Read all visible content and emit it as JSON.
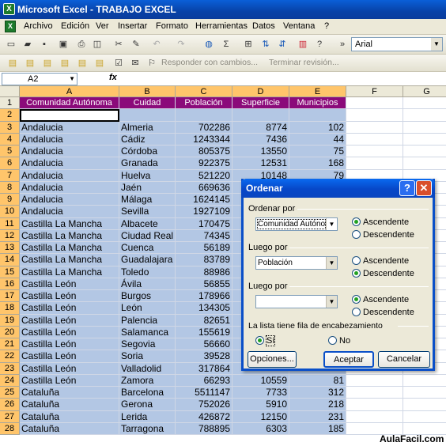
{
  "window": {
    "title": "Microsoft Excel - TRABAJO EXCEL"
  },
  "menu": [
    "Archivo",
    "Edición",
    "Ver",
    "Insertar",
    "Formato",
    "Herramientas",
    "Datos",
    "Ventana",
    "?"
  ],
  "toolbar": {
    "font": "Arial",
    "review_reply": "Responder con cambios...",
    "review_end": "Terminar revisión..."
  },
  "formula": {
    "cell_ref": "A2",
    "fx": "fx"
  },
  "columns": [
    "A",
    "B",
    "C",
    "D",
    "E",
    "F",
    "G"
  ],
  "headers": [
    "Comunidad Autónoma",
    "Cuidad",
    "Población",
    "Superficie",
    "Municipios"
  ],
  "rows": [
    {
      "n": "1"
    },
    {
      "n": "2"
    },
    {
      "n": "3",
      "a": "Andalucia",
      "b": "Almeria",
      "c": "702286",
      "d": "8774",
      "e": "102"
    },
    {
      "n": "4",
      "a": "Andalucia",
      "b": "Cádiz",
      "c": "1243344",
      "d": "7436",
      "e": "44"
    },
    {
      "n": "5",
      "a": "Andalucia",
      "b": "Córdoba",
      "c": "805375",
      "d": "13550",
      "e": "75"
    },
    {
      "n": "6",
      "a": "Andalucia",
      "b": "Granada",
      "c": "922375",
      "d": "12531",
      "e": "168"
    },
    {
      "n": "7",
      "a": "Andalucia",
      "b": "Huelva",
      "c": "521220",
      "d": "10148",
      "e": "79"
    },
    {
      "n": "8",
      "a": "Andalucia",
      "b": "Jaén",
      "c": "669636",
      "d": "",
      "e": ""
    },
    {
      "n": "9",
      "a": "Andalucia",
      "b": "Málaga",
      "c": "1624145",
      "d": "",
      "e": ""
    },
    {
      "n": "10",
      "a": "Andalucia",
      "b": "Sevilla",
      "c": "1927109",
      "d": "",
      "e": ""
    },
    {
      "n": "11",
      "a": "Castilla La Mancha",
      "b": "Albacete",
      "c": "170475",
      "d": "",
      "e": ""
    },
    {
      "n": "12",
      "a": "Castilla La Mancha",
      "b": "Ciudad Real",
      "c": "74345",
      "d": "",
      "e": ""
    },
    {
      "n": "13",
      "a": "Castilla La Mancha",
      "b": "Cuenca",
      "c": "56189",
      "d": "",
      "e": ""
    },
    {
      "n": "14",
      "a": "Castilla La Mancha",
      "b": "Guadalajara",
      "c": "83789",
      "d": "",
      "e": ""
    },
    {
      "n": "15",
      "a": "Castilla La Mancha",
      "b": "Toledo",
      "c": "88986",
      "d": "",
      "e": ""
    },
    {
      "n": "16",
      "a": "Castilla León",
      "b": "Ávila",
      "c": "56855",
      "d": "",
      "e": ""
    },
    {
      "n": "17",
      "a": "Castilla León",
      "b": "Burgos",
      "c": "178966",
      "d": "",
      "e": ""
    },
    {
      "n": "18",
      "a": "Castilla León",
      "b": "León",
      "c": "134305",
      "d": "",
      "e": ""
    },
    {
      "n": "19",
      "a": "Castilla León",
      "b": "Palencia",
      "c": "82651",
      "d": "",
      "e": ""
    },
    {
      "n": "20",
      "a": "Castilla León",
      "b": "Salamanca",
      "c": "155619",
      "d": "",
      "e": ""
    },
    {
      "n": "21",
      "a": "Castilla León",
      "b": "Segovia",
      "c": "56660",
      "d": "",
      "e": ""
    },
    {
      "n": "22",
      "a": "Castilla León",
      "b": "Soria",
      "c": "39528",
      "d": "",
      "e": ""
    },
    {
      "n": "23",
      "a": "Castilla León",
      "b": "Valladolid",
      "c": "317864",
      "d": "",
      "e": ""
    },
    {
      "n": "24",
      "a": "Castilla León",
      "b": "Zamora",
      "c": "66293",
      "d": "10559",
      "e": "81"
    },
    {
      "n": "25",
      "a": "Cataluña",
      "b": "Barcelona",
      "c": "5511147",
      "d": "7733",
      "e": "312"
    },
    {
      "n": "26",
      "a": "Cataluña",
      "b": "Gerona",
      "c": "752026",
      "d": "5910",
      "e": "218"
    },
    {
      "n": "27",
      "a": "Cataluña",
      "b": "Lerida",
      "c": "426872",
      "d": "12150",
      "e": "231"
    },
    {
      "n": "28",
      "a": "Cataluña",
      "b": "Tarragona",
      "c": "788895",
      "d": "6303",
      "e": "185"
    }
  ],
  "dialog": {
    "title": "Ordenar",
    "sort1": {
      "label": "Ordenar por",
      "value": "Comunidad Autónon",
      "asc": "Ascendente",
      "desc": "Descendente"
    },
    "sort2": {
      "label": "Luego por",
      "value": "Población",
      "asc": "Ascendente",
      "desc": "Descendente"
    },
    "sort3": {
      "label": "Luego por",
      "value": "",
      "asc": "Ascendente",
      "desc": "Descendente"
    },
    "header_q": "La lista tiene fila de encabezamiento",
    "yes": "Sí",
    "no": "No",
    "options": "Opciones...",
    "ok": "Aceptar",
    "cancel": "Cancelar"
  },
  "watermark": "AulaFacil.com"
}
